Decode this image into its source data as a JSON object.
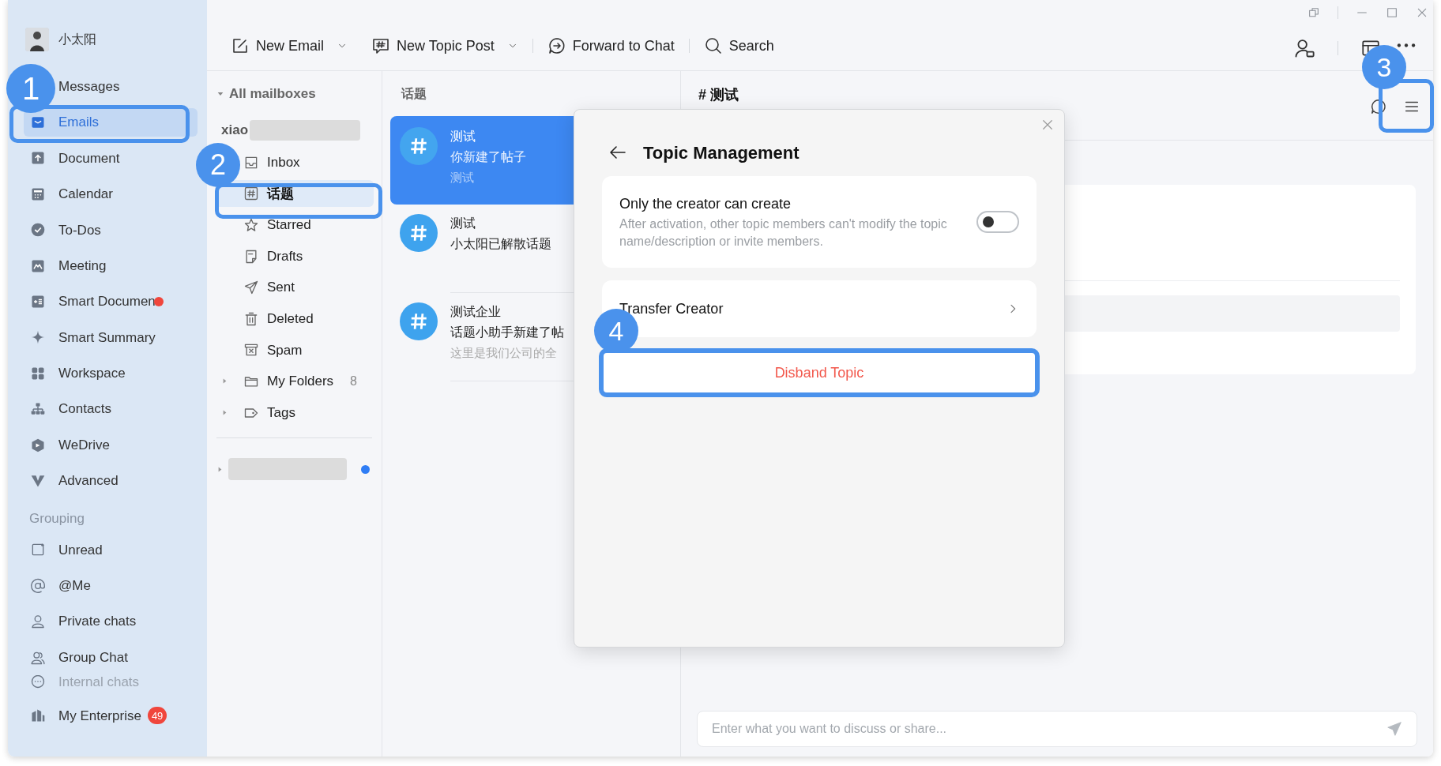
{
  "user": {
    "name": "小太阳"
  },
  "sidebar": {
    "items": [
      {
        "label": "Messages",
        "selected": false,
        "dot": false
      },
      {
        "label": "Emails",
        "selected": true,
        "dot": false
      },
      {
        "label": "Document",
        "selected": false,
        "dot": false
      },
      {
        "label": "Calendar",
        "selected": false,
        "dot": false
      },
      {
        "label": "To-Dos",
        "selected": false,
        "dot": false
      },
      {
        "label": "Meeting",
        "selected": false,
        "dot": false
      },
      {
        "label": "Smart Documen",
        "selected": false,
        "dot": true
      },
      {
        "label": "Smart Summary",
        "selected": false,
        "dot": false
      },
      {
        "label": "Workspace",
        "selected": false,
        "dot": false
      },
      {
        "label": "Contacts",
        "selected": false,
        "dot": false
      },
      {
        "label": "WeDrive",
        "selected": false,
        "dot": false
      },
      {
        "label": "Advanced",
        "selected": false,
        "dot": false
      }
    ],
    "grouping": {
      "title": "Grouping",
      "items": [
        {
          "label": "Unread",
          "selected": false
        },
        {
          "label": "@Me",
          "selected": false
        },
        {
          "label": "Private chats",
          "selected": false
        },
        {
          "label": "Group Chat",
          "selected": false
        },
        {
          "label": "Internal chats",
          "selected": false
        }
      ]
    },
    "footer": {
      "label": "My Enterprise",
      "badge": "49"
    }
  },
  "toolbar": {
    "buttons": [
      {
        "label": "New Email",
        "dropdown": true
      },
      {
        "label": "New Topic Post",
        "dropdown": true
      },
      {
        "label": "Forward to Chat",
        "dropdown": false
      },
      {
        "label": "Search",
        "dropdown": false
      }
    ]
  },
  "mailboxes": {
    "header": "All mailboxes",
    "account": "xiao",
    "folders": [
      {
        "label": "Inbox",
        "selected": false,
        "kind": "folder"
      },
      {
        "label": "话题",
        "selected": true,
        "kind": "folder"
      },
      {
        "label": "Starred",
        "selected": false,
        "kind": "folder"
      },
      {
        "label": "Drafts",
        "selected": false,
        "kind": "folder"
      },
      {
        "label": "Sent",
        "selected": false,
        "kind": "folder"
      },
      {
        "label": "Deleted",
        "selected": false,
        "kind": "folder"
      },
      {
        "label": "Spam",
        "selected": false,
        "kind": "folder"
      },
      {
        "label": "My Folders",
        "selected": false,
        "kind": "group",
        "count": "8"
      },
      {
        "label": "Tags",
        "selected": false,
        "kind": "group"
      }
    ],
    "second_account": {
      "unread": true
    }
  },
  "topics": {
    "header": "话题",
    "items": [
      {
        "title": "测试",
        "preview": "你新建了帖子",
        "subtitle": "测试",
        "selected": true
      },
      {
        "title": "测试",
        "preview": "小太阳已解散话题",
        "selected": false
      },
      {
        "title": "测试企业",
        "preview": "话题小助手新建了帖",
        "subtitle": "这里是我们公司的全",
        "selected": false
      }
    ]
  },
  "conversation": {
    "title": "# 测试",
    "composer": {
      "placeholder": "Enter what you want to discuss or share..."
    }
  },
  "dialog": {
    "title": "Topic Management",
    "setting": {
      "title": "Only the creator can create",
      "description": "After activation, other topic members can't modify the topic name/description or invite members.",
      "on": false
    },
    "transfer": {
      "label": "Transfer Creator"
    },
    "disband": {
      "label": "Disband Topic"
    }
  },
  "annotations": [
    {
      "label": "1"
    },
    {
      "label": "2"
    },
    {
      "label": "3"
    },
    {
      "label": "4"
    }
  ]
}
